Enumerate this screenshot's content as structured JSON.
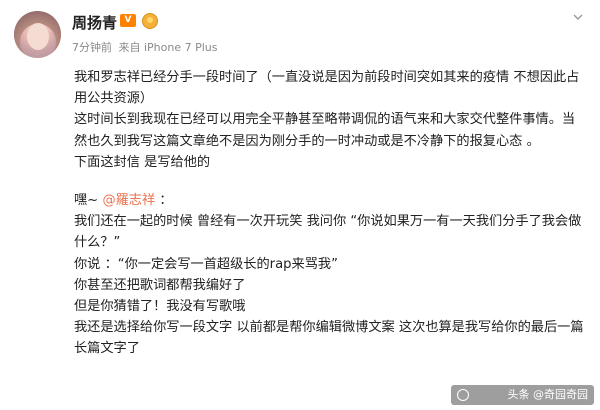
{
  "post": {
    "username": "周扬青",
    "vip_label": "V",
    "time": "7分钟前",
    "source": "来自 iPhone 7 Plus",
    "paragraphs": [
      "我和罗志祥已经分手一段时间了（一直没说是因为前段时间突如其来的疫情 不想因此占用公共资源）",
      "这时间长到我现在已经可以用完全平静甚至略带调侃的语气来和大家交代整件事情。当然也久到我写这篇文章绝不是因为刚分手的一时冲动或是不冷静下的报复心态 。",
      "下面这封信 是写给他的"
    ],
    "letter_intro": "嘿~ ",
    "mention": "@羅志祥",
    "letter_intro_end": " ：",
    "letter_lines": [
      "我们还在一起的时候 曾经有一次开玩笑 我问你 “你说如果万一有一天我们分手了我会做什么？”",
      "你说 ：“你一定会写一首超级长的rap来骂我”",
      "你甚至还把歌词都帮我编好了",
      "但是你猜错了！我没有写歌哦",
      "我还是选择给你写一段文字 以前都是帮你编辑微博文案 这次也算是我写给你的最后一篇长篇文字了"
    ]
  },
  "watermark": {
    "text": "头条 @奇园奇园"
  },
  "colors": {
    "mention": "#eb7350",
    "meta_text": "#8a8a8a",
    "vip": "#ff8200"
  }
}
